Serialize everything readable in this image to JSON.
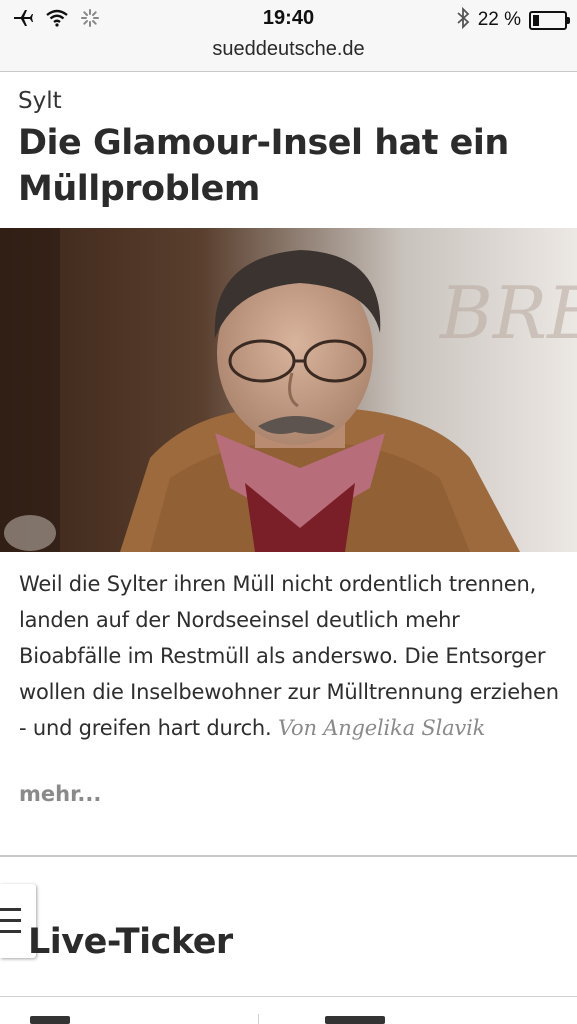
{
  "status_bar": {
    "time": "19:40",
    "battery_percent": "22 %",
    "battery_level": 0.22,
    "icons": [
      "airplane-icon",
      "wifi-icon",
      "activity-spinner-icon",
      "bluetooth-icon",
      "battery-icon"
    ]
  },
  "browser": {
    "url": "sueddeutsche.de"
  },
  "article": {
    "kicker": "Sylt",
    "headline": "Die Glamour-Insel hat ein Müllproblem",
    "teaser": "Weil die Sylter ihren Müll nicht ordentlich trennen, landen auf der Nordseeinsel deutlich mehr Bioabfälle im Restmüll als anderswo. Die Entsorger wollen die Inselbewohner zur Mülltrennung erziehen - und greifen hart durch.",
    "author": "Von Angelika Slavik",
    "more_link": "mehr..."
  },
  "section": {
    "title": "Live-Ticker"
  },
  "menu": {
    "icon": "hamburger-menu-icon"
  },
  "colors": {
    "text": "#2b2b2b",
    "muted": "#8a8a8a",
    "divider": "#c9c9c9",
    "chrome_bg": "#f7f7f7"
  }
}
